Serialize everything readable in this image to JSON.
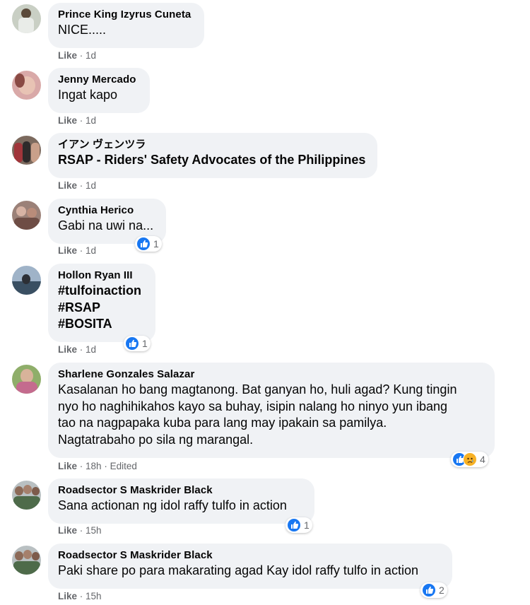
{
  "colors": {
    "bubble": "#f0f2f5",
    "text": "#050505",
    "secondary": "#65676b",
    "like_blue": "#1877f2",
    "sad_yellow": "#f7b125"
  },
  "comments": [
    {
      "author": "Prince King Izyrus Cuneta",
      "lines": [
        "NICE....."
      ],
      "like_label": "Like",
      "time": "1d",
      "edited": "",
      "reaction_count": ""
    },
    {
      "author": "Jenny Mercado",
      "lines": [
        "Ingat kapo"
      ],
      "like_label": "Like",
      "time": "1d",
      "edited": "",
      "reaction_count": ""
    },
    {
      "author": "イアン ヴェンツラ",
      "lines": [
        "RSAP - Riders' Safety Advocates of the Philippines"
      ],
      "like_label": "Like",
      "time": "1d",
      "edited": "",
      "reaction_count": ""
    },
    {
      "author": "Cynthia Herico",
      "lines": [
        "Gabi na uwi na..."
      ],
      "like_label": "Like",
      "time": "1d",
      "edited": "",
      "reaction_count": "1"
    },
    {
      "author": "Hollon Ryan III",
      "lines": [
        "#tulfoinaction",
        "#RSAP",
        "#BOSITA"
      ],
      "like_label": "Like",
      "time": "1d",
      "edited": "",
      "reaction_count": "1"
    },
    {
      "author": "Sharlene Gonzales Salazar",
      "lines": [
        "Kasalanan ho bang magtanong. Bat ganyan ho, huli agad? Kung tingin",
        "nyo ho naghihikahos kayo sa buhay, isipin nalang ho ninyo yun ibang",
        "tao na nagpapaka kuba para lang may ipakain sa pamilya.",
        "Nagtatrabaho po sila ng marangal."
      ],
      "like_label": "Like",
      "time": "18h",
      "edited": "Edited",
      "reaction_count": "4"
    },
    {
      "author": "Roadsector S Maskrider Black",
      "lines": [
        "Sana actionan ng idol raffy tulfo in action"
      ],
      "like_label": "Like",
      "time": "15h",
      "edited": "",
      "reaction_count": "1"
    },
    {
      "author": "Roadsector S Maskrider Black",
      "lines": [
        "Paki share po para makarating agad Kay idol raffy tulfo in action"
      ],
      "like_label": "Like",
      "time": "15h",
      "edited": "",
      "reaction_count": "2"
    }
  ]
}
